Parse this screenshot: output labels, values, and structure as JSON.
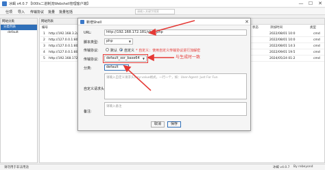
{
  "app": {
    "title": "冰蝎 v4.0.7 【t00ls二进制流Webshell管理客户端】",
    "window_buttons": [
      "—",
      "☐",
      "✕"
    ]
  },
  "menu": {
    "items": [
      "仕项",
      "导入",
      "传输协议",
      "批量",
      "批量包括"
    ],
    "search_placeholder": "请输入关键字搜索"
  },
  "sidebar": {
    "header": "网站分类",
    "items": [
      {
        "label": "分类列表",
        "selected": true
      },
      {
        "label": "default",
        "selected": false
      }
    ]
  },
  "main": {
    "header": "网站列表",
    "columns": [
      "编号",
      "URL",
      "IP",
      "备注",
      "状态",
      "添加时间",
      "类型"
    ],
    "rows": [
      {
        "no": "1",
        "url": "http://192.168.3.2/",
        "date": "2022/08/01 10:0",
        "type": "cmd"
      },
      {
        "no": "2",
        "url": "http://127.0.0.1:80/",
        "date": "2022/08/01 10:0",
        "type": "cmd"
      },
      {
        "no": "3",
        "url": "http://127.0.0.1:80/",
        "date": "2022/08/01 14:3",
        "type": "cmd"
      },
      {
        "no": "4",
        "url": "http://127.0.0.1:80/",
        "date": "2022/09/01 19:5",
        "type": "cmd"
      },
      {
        "no": "5",
        "url": "http://192.168.172.18/",
        "date": "2024/05/24 01:2",
        "type": "cmd"
      }
    ]
  },
  "statusbar": {
    "left": "请勿用于非法用途",
    "right": "冰蝎 v4.0.7",
    "by": "By rebeyond"
  },
  "dialog": {
    "title": "新增Shell",
    "close": "✕",
    "url_label": "URL:",
    "url_value": "http://192.168.172.181/shell.php",
    "script_type_label": "脚本类型:",
    "script_type_value": "php",
    "protocol_label": "传输协议:",
    "protocol_radio_default": "默认",
    "protocol_radio_custom": "自定义",
    "protocol_custom_note": "* 自定义：使用自定义传输协议进行加解密",
    "encoder_label": "传输协议:",
    "encoder_value": "default_xor_base64",
    "category_label": "分类:",
    "category_value": "default",
    "headers_label": "自定义请求头:",
    "headers_placeholder": "请输入自定义请求头(key:value格式，一行一个，如：User-Agent: Just For Fun",
    "remark_label": "备注:",
    "remark_placeholder": "请输入备注",
    "cancel_label": "取消",
    "save_label": "保存"
  },
  "annotation": {
    "text": "与生成时一致",
    "color": "#e53935"
  },
  "colors": {
    "accent": "#2f6fb8",
    "annotation_red": "#e53935"
  }
}
